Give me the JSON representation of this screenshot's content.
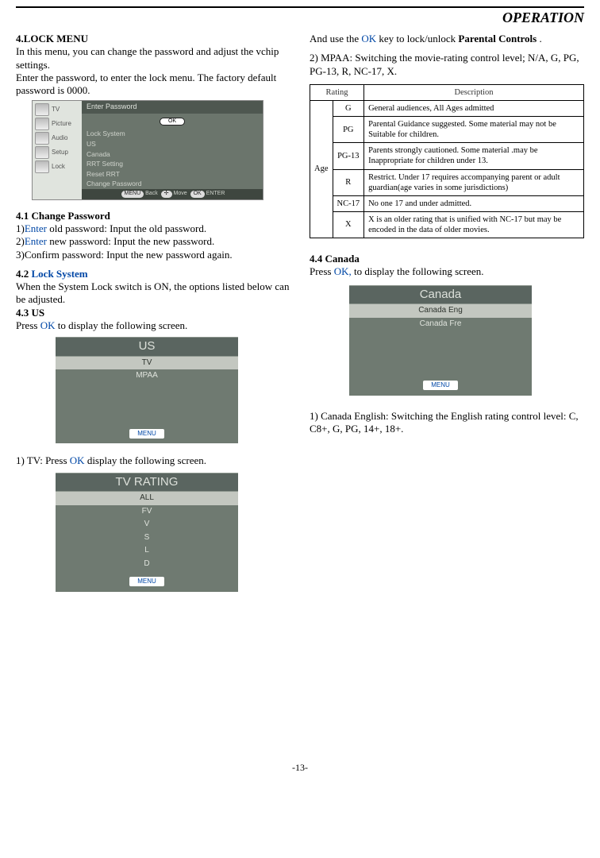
{
  "header": "OPERATION",
  "left": {
    "h1": "4.LOCK MENU",
    "p1": "In this menu, you can change the password and adjust the vchip settings.",
    "p2": "Enter the password, to enter the lock menu. The factory default password is 0000.",
    "osd": {
      "side_tv": "TV",
      "side_picture": "Picture",
      "side_audio": "Audio",
      "side_setup": "Setup",
      "side_lock": "Lock",
      "title": "Enter Password",
      "ok": "OK",
      "rows": [
        "Lock System",
        "US",
        "Canada",
        "RRT Setting",
        "Reset RRT",
        "Change Password"
      ],
      "foot_menu": "MENU",
      "foot_back": "Back",
      "foot_move": "Move",
      "foot_ok": "OK",
      "foot_enter": "ENTER"
    },
    "h41": "4.1 Change Password",
    "l1a": "1)",
    "l1b": "Enter",
    "l1c": " old password: Input the old password.",
    "l2a": "2)",
    "l2b": "Enter",
    "l2c": " new password: Input the new password.",
    "l3": "3)Confirm password: Input the new password again.",
    "h42a": "4.2 ",
    "h42b": "Lock System",
    "p42": "When the System Lock switch is ON, the options listed below can be adjusted.",
    "h43": "4.3 US",
    "p43a": "Press ",
    "p43b": "OK",
    "p43c": " to display the following screen.",
    "us_panel": {
      "title": "US",
      "rows": [
        "TV",
        "MPAA"
      ],
      "menu": "MENU"
    },
    "tvline_a": "1) TV: Press ",
    "tvline_b": "OK",
    "tvline_c": " display the following screen.",
    "tvr_panel": {
      "title": "TV RATING",
      "rows": [
        "ALL",
        "FV",
        "V",
        "S",
        "L",
        "D"
      ],
      "menu": "MENU"
    }
  },
  "right": {
    "p1a": "And use the ",
    "p1b": "OK",
    "p1c": " key to lock/unlock ",
    "p1d": "Parental Controls",
    "p1e": " .",
    "p2": "2) MPAA: Switching the movie-rating control level; N/A, G, PG, PG-13, R, NC-17, X.",
    "table": {
      "hdr_rating": "Rating",
      "hdr_desc": "Description",
      "age": "Age",
      "rows": [
        {
          "r": "G",
          "d": "General audiences, All Ages admitted"
        },
        {
          "r": "PG",
          "d": "Parental Guidance suggested. Some material may not be Suitable for children."
        },
        {
          "r": "PG-13",
          "d": "Parents strongly cautioned. Some material .may be Inappropriate for children under 13."
        },
        {
          "r": "R",
          "d": "Restrict. Under 17 requires accompanying parent or adult guardian(age varies in some jurisdictions)"
        },
        {
          "r": "NC-17",
          "d": "No one 17 and under admitted."
        },
        {
          "r": "X",
          "d": "X  is an older rating that is unified with NC-17 but may be encoded in the data of older movies."
        }
      ]
    },
    "h44": "4.4 Canada",
    "p44a": "Press ",
    "p44b": "OK,",
    "p44c": " to display the following screen.",
    "ca_panel": {
      "title": "Canada",
      "rows": [
        "Canada Eng",
        "Canada Fre"
      ],
      "menu": "MENU"
    },
    "p45": "1) Canada English: Switching the English rating control level: C, C8+, G, PG, 14+, 18+."
  },
  "pagenum": "-13-"
}
